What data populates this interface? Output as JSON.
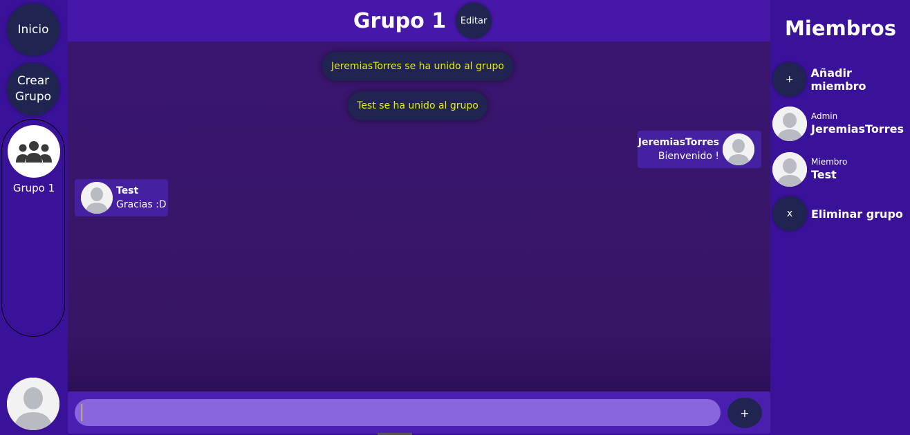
{
  "sidebar": {
    "home_label": "Inicio",
    "create_group_label": "Crear\nGrupo",
    "groups": [
      {
        "label": "Grupo 1",
        "icon": "users-icon"
      }
    ],
    "user_avatar_icon": "user-icon"
  },
  "chat": {
    "title": "Grupo 1",
    "edit_label": "Editar",
    "system_messages": [
      "JeremiasTorres se ha unido al grupo",
      "Test se ha unido al grupo"
    ],
    "messages": [
      {
        "sender": "JeremiasTorres",
        "text": "Bienvenido !",
        "align": "right"
      },
      {
        "sender": "Test",
        "text": "Gracias :D",
        "align": "left"
      }
    ],
    "input_value": "",
    "send_label": "+"
  },
  "members_panel": {
    "title": "Miembros",
    "add_label": "Añadir miembro",
    "add_icon": "+",
    "members": [
      {
        "role": "Admin",
        "name": "JeremiasTorres"
      },
      {
        "role": "Miembro",
        "name": "Test"
      }
    ],
    "delete_label": "Eliminar grupo",
    "delete_icon": "x"
  },
  "colors": {
    "background": "#3a129a",
    "header": "#4617a8",
    "dark_button": "#1f2550",
    "system_text": "#e8f000",
    "input": "#8a66dd"
  }
}
